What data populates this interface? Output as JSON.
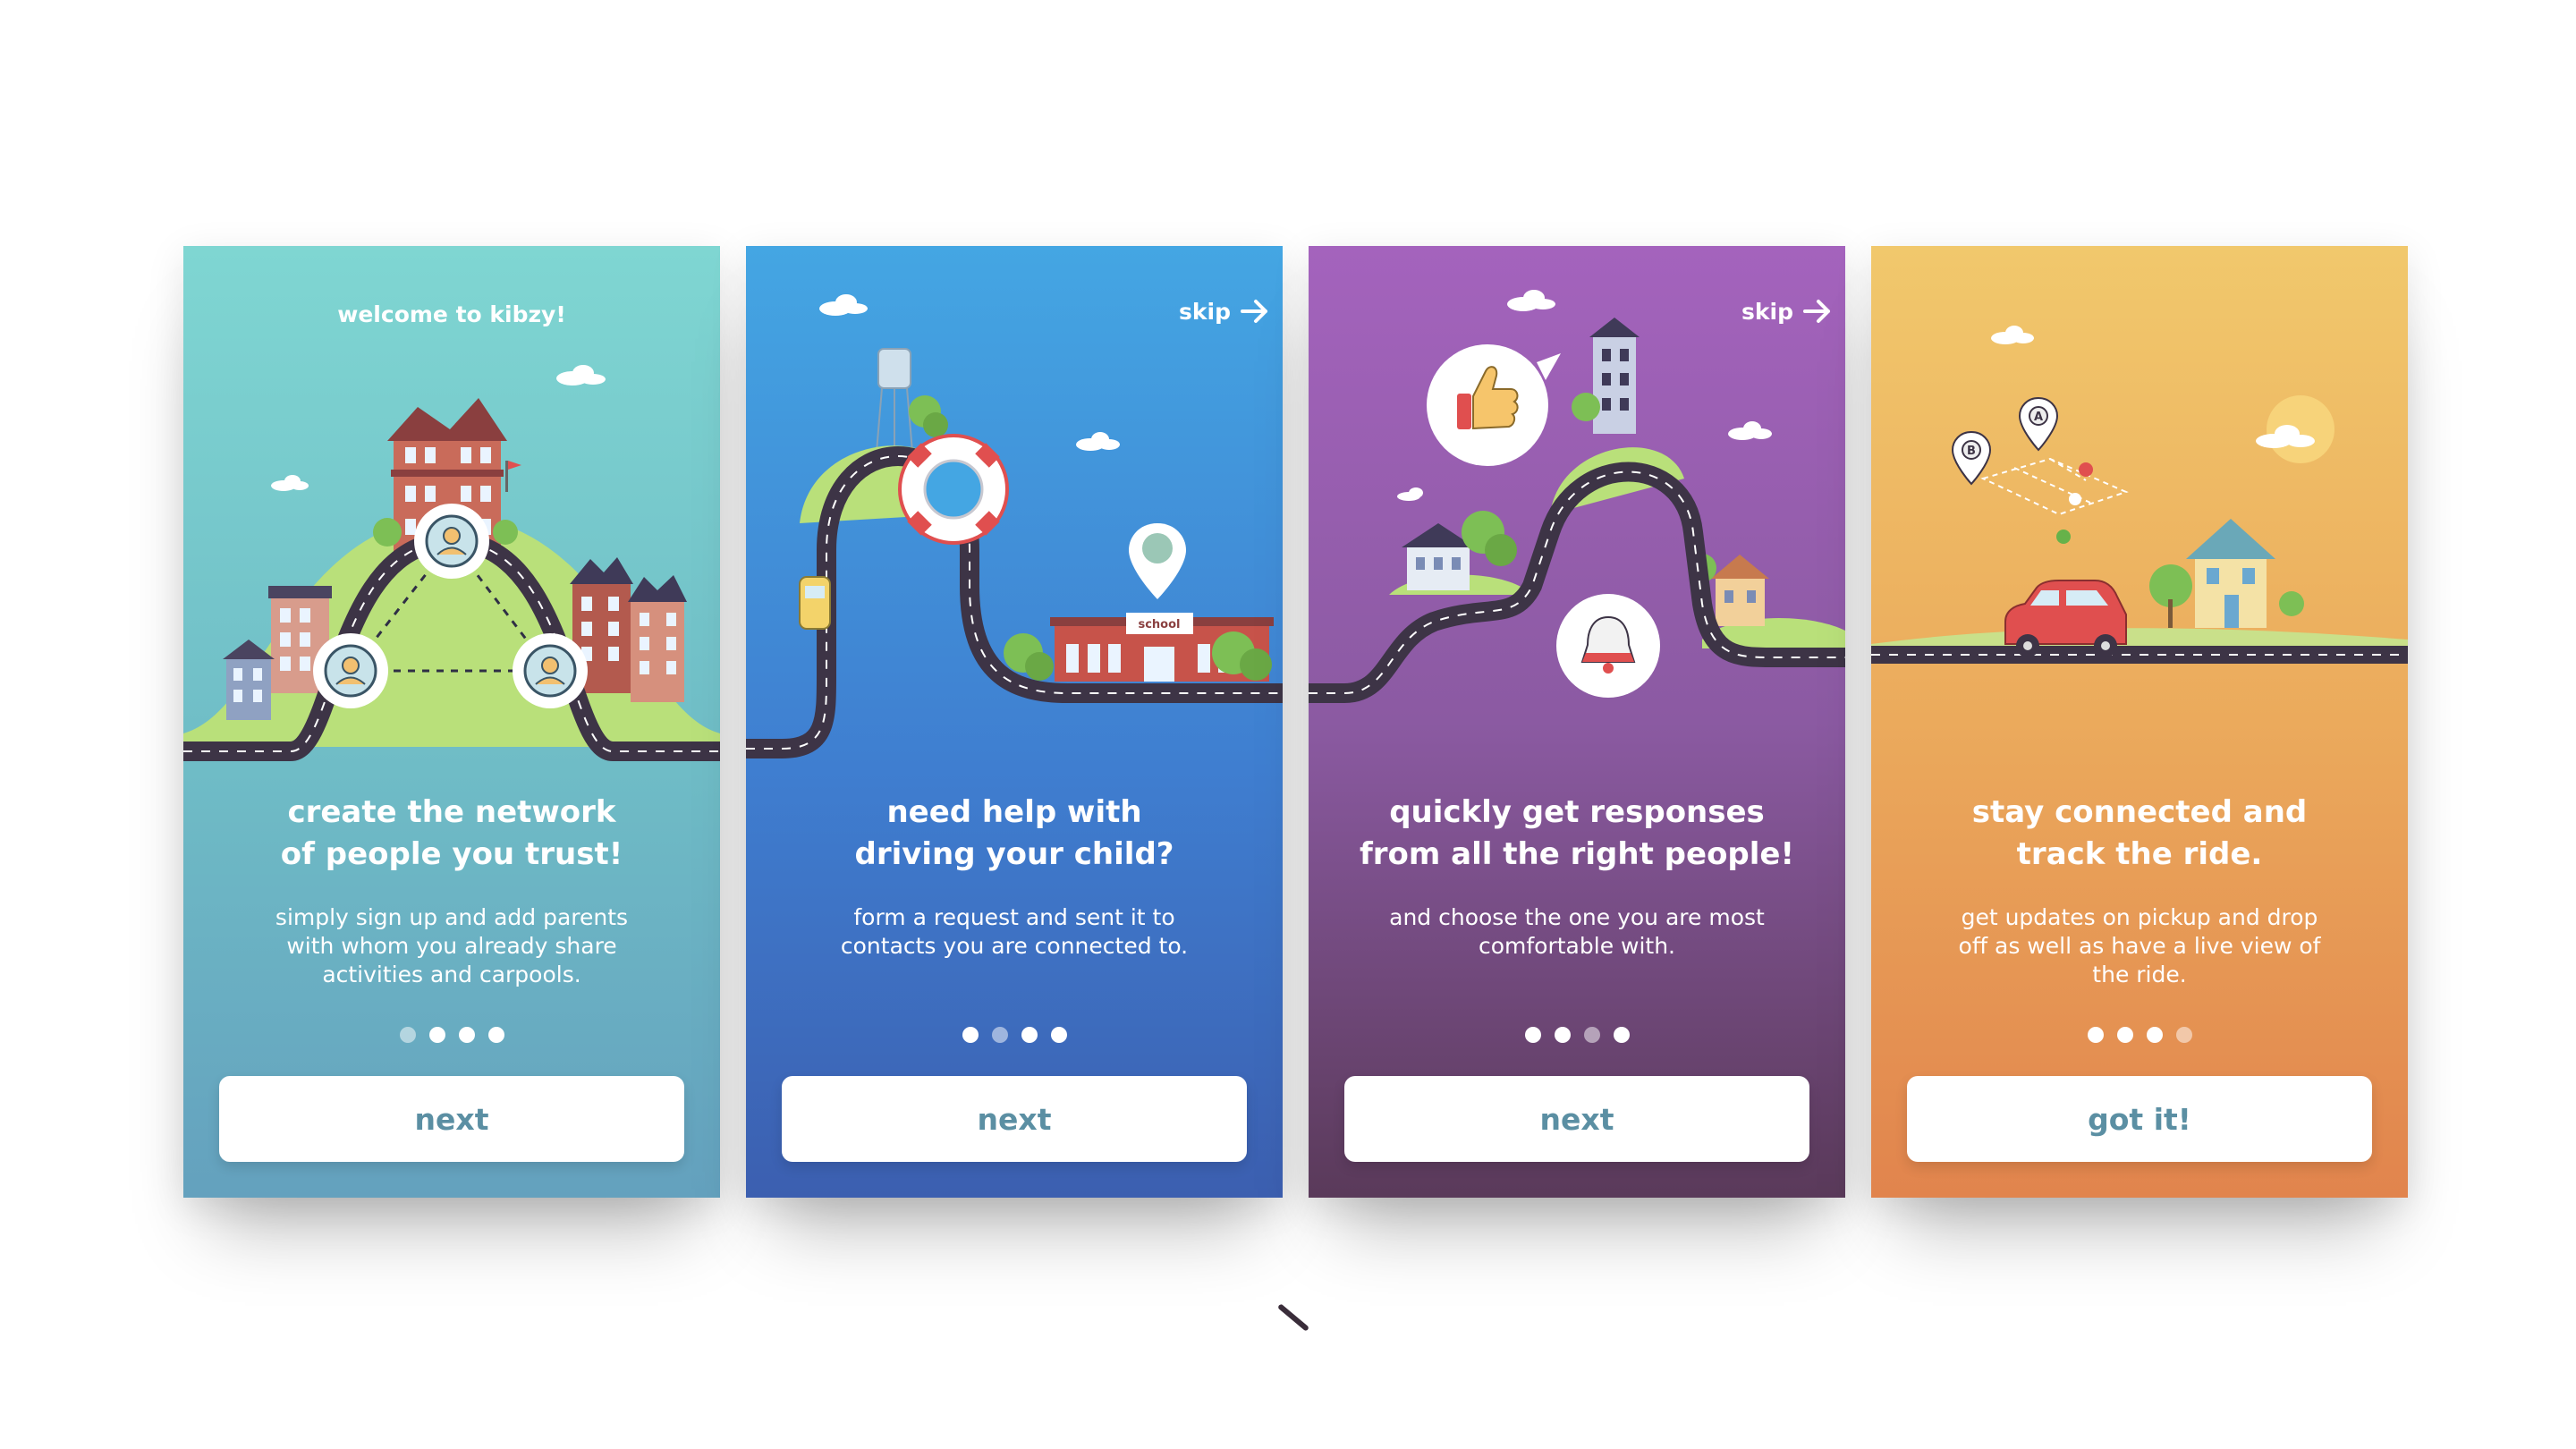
{
  "screens": [
    {
      "header": "welcome to kibzy!",
      "title_lines": [
        "create the network",
        "of people you trust!"
      ],
      "body_lines": [
        "simply sign up and add parents",
        "with whom you already share",
        "activities and carpools."
      ],
      "button": "next",
      "active_dot": 1
    },
    {
      "skip": "skip",
      "title_lines": [
        "need help with",
        "driving your child?"
      ],
      "body_lines": [
        "form a request and sent it to",
        "contacts you are connected to."
      ],
      "button": "next",
      "active_dot": 2,
      "building_label": "school"
    },
    {
      "skip": "skip",
      "title_lines": [
        "quickly get responses",
        "from all the right people!"
      ],
      "body_lines": [
        "and choose the one you are most",
        "comfortable with."
      ],
      "button": "next",
      "active_dot": 3
    },
    {
      "title_lines": [
        "stay connected and",
        "track the ride."
      ],
      "body_lines": [
        "get updates on pickup and drop",
        "off as well as have a live view of",
        "the ride."
      ],
      "button": "got it!",
      "active_dot": 4,
      "pin_a": "A",
      "pin_b": "B"
    }
  ],
  "icons": [
    "arrow-right-icon",
    "user-icon",
    "thumbs-up-icon",
    "bell-icon",
    "map-pin-icon",
    "car-icon",
    "lifebuoy-icon"
  ],
  "colors": {
    "screen1": "#7fd6d2",
    "screen2": "#44a6e3",
    "screen3": "#a463bd",
    "screen4": "#f1c86c",
    "button_text": "#5b8fa3",
    "road": "#3d3446"
  }
}
